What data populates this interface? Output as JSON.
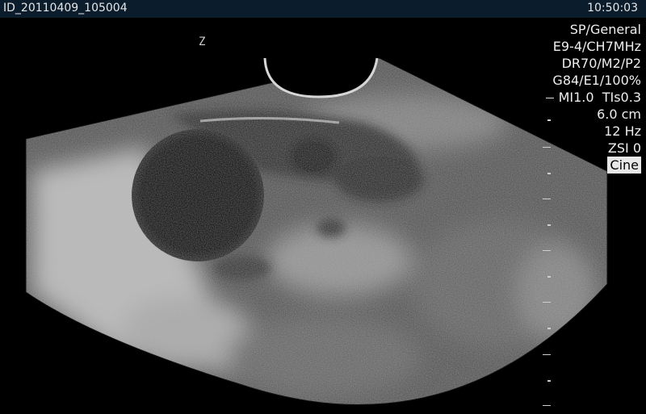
{
  "header": {
    "patient_id": "ID_20110409_105004",
    "time": "10:50:03"
  },
  "params": {
    "preset": "SP/General",
    "probe": "E9-4/CH7MHz",
    "dr": "DR70/M2/P2",
    "gain": "G84/E1/100%",
    "mi": "MI1.0",
    "tis": "TIs0.3",
    "depth": "6.0 cm",
    "frame_rate": "12 Hz",
    "zsi": "ZSI 0",
    "mode": "Cine"
  },
  "orientation_marker": "Z",
  "colors": {
    "bar": "#0b1c2c",
    "text": "#e8e8e8",
    "background": "#000000"
  }
}
